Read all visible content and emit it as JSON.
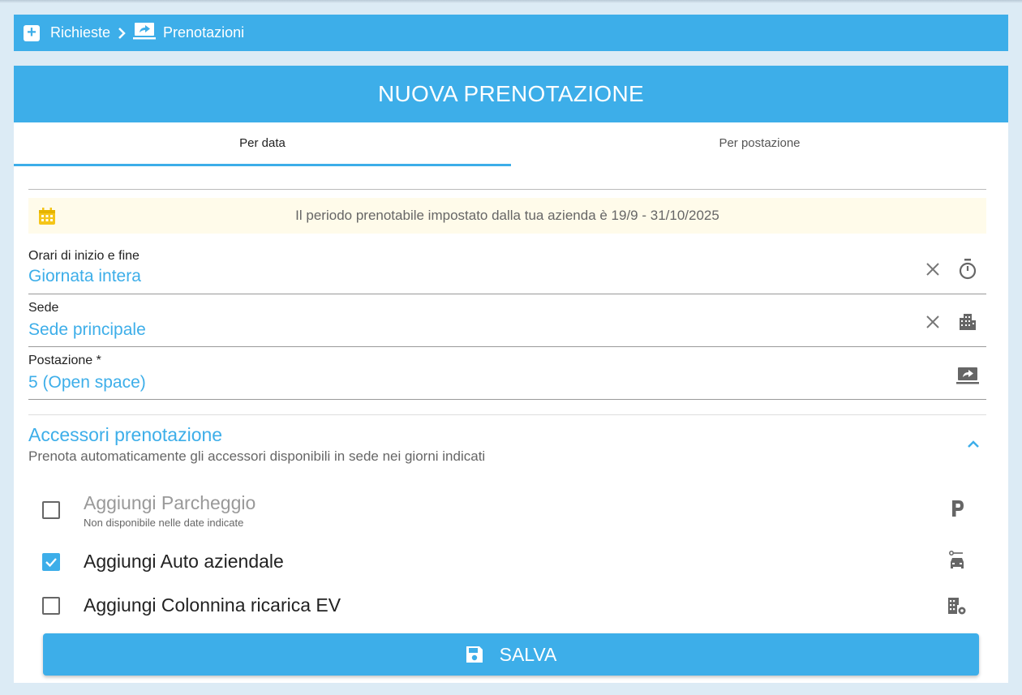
{
  "breadcrumb": {
    "items": [
      "Richieste",
      "Prenotazioni"
    ]
  },
  "header": {
    "title": "NUOVA PRENOTAZIONE"
  },
  "tabs": [
    {
      "label": "Per data",
      "active": true
    },
    {
      "label": "Per postazione",
      "active": false
    }
  ],
  "notice": {
    "text": "Il periodo prenotabile impostato dalla tua azienda è 19/9 - 31/10/2025",
    "icon": "calendar-icon"
  },
  "fields": {
    "orari": {
      "label": "Orari di inizio e fine",
      "value": "Giornata intera"
    },
    "sede": {
      "label": "Sede",
      "value": "Sede principale"
    },
    "postazione": {
      "label": "Postazione  *",
      "value": "5  (Open space)"
    }
  },
  "accessories": {
    "title": "Accessori prenotazione",
    "subtitle": "Prenota automaticamente gli accessori disponibili in sede nei giorni indicati",
    "items": [
      {
        "label": "Aggiungi Parcheggio",
        "hint": "Non disponibile nelle date indicate",
        "checked": false,
        "disabled": true,
        "icon": "parking-icon"
      },
      {
        "label": "Aggiungi Auto aziendale",
        "checked": true,
        "disabled": false,
        "icon": "car-icon"
      },
      {
        "label": "Aggiungi Colonnina ricarica EV",
        "checked": false,
        "disabled": false,
        "icon": "building-gear-icon"
      }
    ]
  },
  "save": {
    "label": "SALVA"
  },
  "colors": {
    "primary": "#3daee9",
    "notice_bg": "#fffbea",
    "page_bg": "#dcebf5"
  }
}
